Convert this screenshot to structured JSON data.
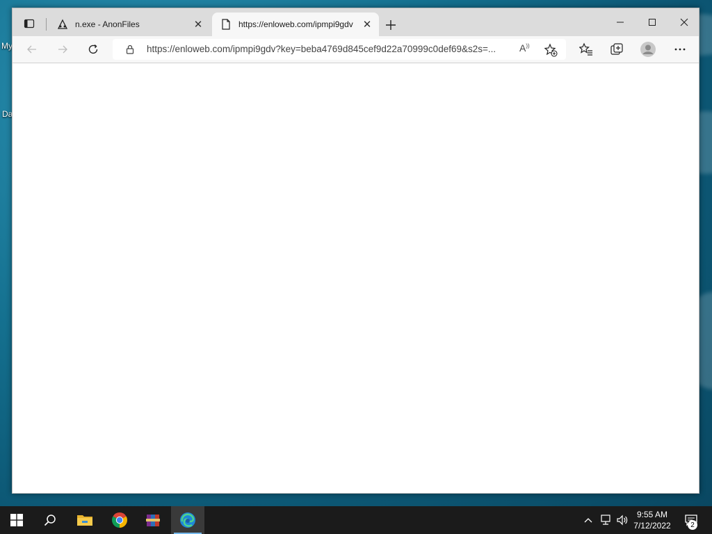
{
  "desktop": {
    "icon_label_1": "My",
    "icon_label_2": "Da"
  },
  "browser": {
    "tabs": [
      {
        "title": "n.exe - AnonFiles",
        "icon": "anonfiles-icon",
        "active": false
      },
      {
        "title": "https://enloweb.com/ipmpi9gdv",
        "icon": "page-icon",
        "active": true
      }
    ],
    "address_bar": {
      "url": "https://enloweb.com/ipmpi9gdv?key=beba4769d845cef9d22a70999c0def69&s2s=..."
    }
  },
  "taskbar": {
    "apps": [
      "start-icon",
      "search-icon",
      "file-explorer-icon",
      "chrome-icon",
      "winrar-icon",
      "edge-icon"
    ],
    "clock": {
      "time": "9:55 AM",
      "date": "7/12/2022"
    },
    "notification_count": "2"
  }
}
